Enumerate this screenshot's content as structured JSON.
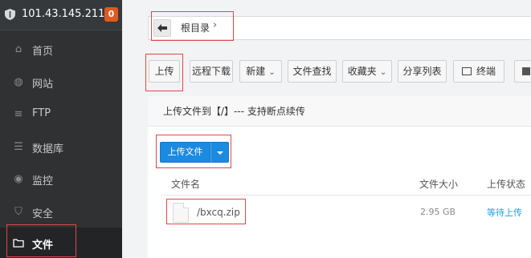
{
  "server": {
    "ip": "101.43.145.211",
    "badge": "0"
  },
  "sidebar": {
    "items": [
      {
        "label": "首页",
        "icon": "home-icon"
      },
      {
        "label": "网站",
        "icon": "globe-icon"
      },
      {
        "label": "FTP",
        "icon": "ftp-icon"
      },
      {
        "label": "数据库",
        "icon": "database-icon"
      },
      {
        "label": "监控",
        "icon": "monitor-icon"
      },
      {
        "label": "安全",
        "icon": "shield-icon"
      },
      {
        "label": "文件",
        "icon": "folder-icon",
        "active": true
      }
    ]
  },
  "path": {
    "root": "根目录"
  },
  "toolbar": {
    "upload": "上传",
    "remote_download": "远程下载",
    "new": "新建",
    "file_search": "文件查找",
    "favorites": "收藏夹",
    "share_list": "分享列表",
    "terminal": "终端"
  },
  "dialog": {
    "title": "上传文件到【/】--- 支持断点续传",
    "upload_button": "上传文件",
    "columns": {
      "name": "文件名",
      "size": "文件大小",
      "status": "上传状态"
    },
    "files": [
      {
        "name": "/bxcq.zip",
        "size": "2.95 GB",
        "status": "等待上传"
      }
    ]
  },
  "colors": {
    "accent": "#1a8be0",
    "sidebar_bg": "#2f3133",
    "highlight": "#e04848",
    "status": "#20a0e0"
  }
}
